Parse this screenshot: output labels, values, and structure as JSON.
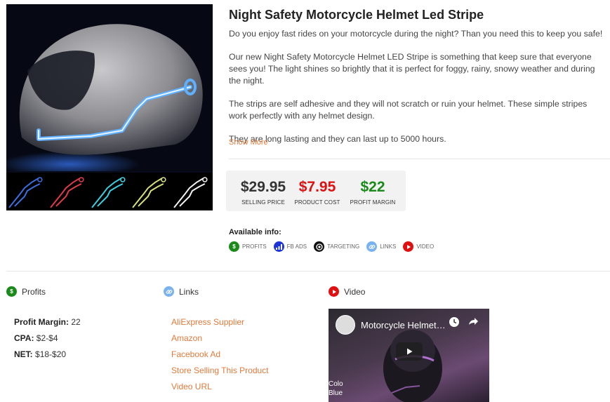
{
  "product": {
    "title": "Night Safety Motorcycle Helmet Led Stripe",
    "description": [
      "Do you enjoy fast rides on your motorcycle during the night? Than you need this to keep you safe!",
      "Our new Night Safety Motorcycle Helmet LED Stripe is something that keep sure that everyone sees you! The light shines so brightly that it is perfect for foggy, rainy, snowy weather and during the night.",
      "The strips are self adhesive and they will not scratch or ruin your helmet. These simple stripes work perfectly with any helmet design.",
      "They are long lasting and they can last up to 5000 hours."
    ],
    "show_more": "Show More",
    "thumbnail_colors": [
      "#3b6fe0",
      "#e03b4a",
      "#3bd0e0",
      "#d8e07a",
      "#f2f2f2"
    ]
  },
  "pricing": {
    "selling_price": {
      "value": "$29.95",
      "label": "SELLING PRICE",
      "color": "#333333"
    },
    "product_cost": {
      "value": "$7.95",
      "label": "PRODUCT COST",
      "color": "#dd1111"
    },
    "profit_margin": {
      "value": "$22",
      "label": "PROFIT MARGIN",
      "color": "#1a8a1a"
    }
  },
  "available": {
    "title": "Available info:",
    "items": [
      {
        "label": "PROFITS",
        "icon": "dollar-icon",
        "color": "#1a8a1a"
      },
      {
        "label": "FB ADS",
        "icon": "bar-chart-icon",
        "color": "#1d34d6"
      },
      {
        "label": "TARGETING",
        "icon": "target-icon",
        "color": "#111111"
      },
      {
        "label": "LINKS",
        "icon": "link-icon",
        "color": "#7ab2f0"
      },
      {
        "label": "VIDEO",
        "icon": "play-icon",
        "color": "#e01010"
      }
    ]
  },
  "sections": {
    "profits": {
      "title": "Profits",
      "lines": [
        {
          "key": "Profit Margin:",
          "value": "22"
        },
        {
          "key": "CPA:",
          "value": "$2-$4"
        },
        {
          "key": "NET:",
          "value": "$18-$20"
        }
      ]
    },
    "links": {
      "title": "Links",
      "items": [
        "AliExpress Supplier",
        "Amazon",
        "Facebook Ad",
        "Store Selling This Product",
        "Video URL"
      ]
    },
    "video": {
      "title": "Video",
      "video_title": "Motorcycle Helmet LED Stripe",
      "caption_line1": "Colo",
      "caption_line2": "Blue"
    }
  }
}
